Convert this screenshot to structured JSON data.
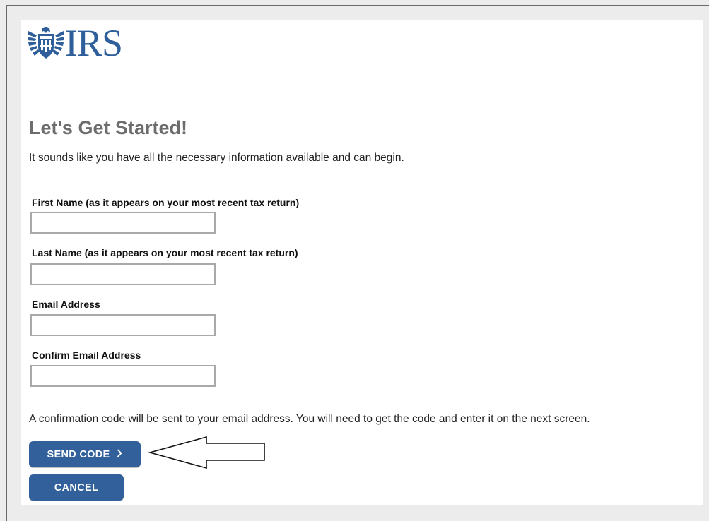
{
  "logo": {
    "text": "IRS",
    "emblem_icon": "eagle-emblem-icon",
    "color": "#2f5f9a"
  },
  "page": {
    "title": "Let's Get Started!",
    "intro": "It sounds like you have all the necessary information available and can begin."
  },
  "form": {
    "first_name": {
      "label": "First Name (as it appears on your most recent tax return)",
      "value": "",
      "placeholder": ""
    },
    "last_name": {
      "label": "Last Name (as it appears on your most recent tax return)",
      "value": "",
      "placeholder": ""
    },
    "email": {
      "label": "Email Address",
      "value": "",
      "placeholder": ""
    },
    "confirm_email": {
      "label": "Confirm Email Address",
      "value": "",
      "placeholder": ""
    }
  },
  "note": "A confirmation code will be sent to your email address. You will need to get the code and enter it on the next screen.",
  "buttons": {
    "send_code": "SEND CODE",
    "send_code_icon": "chevron-right-icon",
    "cancel": "CANCEL",
    "color": "#31609b"
  },
  "annotation": {
    "icon": "left-arrow-annotation-icon"
  }
}
